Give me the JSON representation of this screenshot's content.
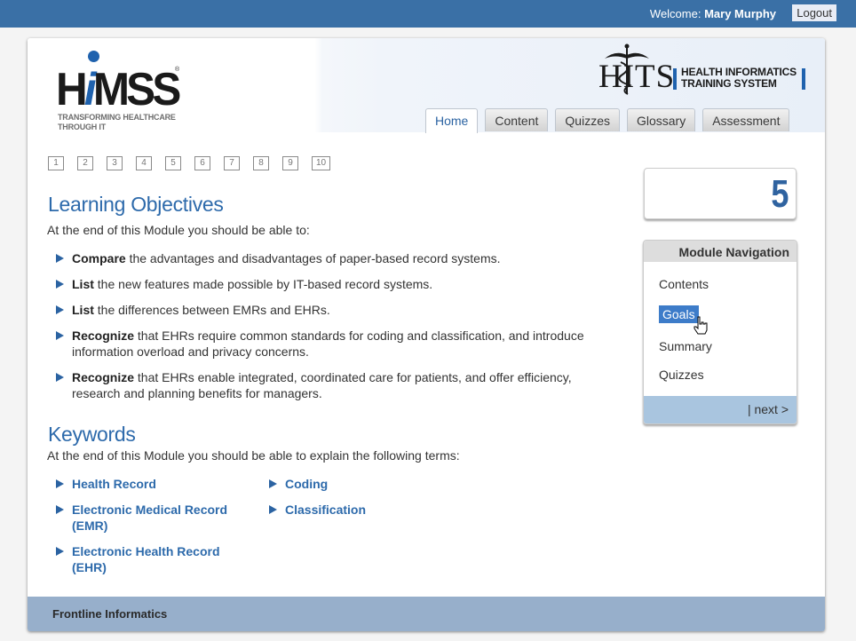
{
  "topbar": {
    "welcome_label": "Welcome:",
    "user_name": "Mary Murphy",
    "logout_label": "Logout"
  },
  "header": {
    "himss_logo": {
      "word_prefix": "H",
      "word_i": "i",
      "word_suffix": "MSS",
      "registered": "®",
      "tagline_line1": "TRANSFORMING HEALTHCARE",
      "tagline_line2": "THROUGH IT"
    },
    "hits_logo": {
      "letters": "HITS",
      "line1": "HEALTH INFORMATICS",
      "line2": "TRAINING SYSTEM"
    },
    "tabs": [
      {
        "label": "Home",
        "active": true
      },
      {
        "label": "Content",
        "active": false
      },
      {
        "label": "Quizzes",
        "active": false
      },
      {
        "label": "Glossary",
        "active": false
      },
      {
        "label": "Assessment",
        "active": false
      }
    ]
  },
  "pager": [
    "1",
    "2",
    "3",
    "4",
    "5",
    "6",
    "7",
    "8",
    "9",
    "10"
  ],
  "objectives": {
    "title": "Learning Objectives",
    "intro": "At the end of this Module you should be able to:",
    "items": [
      {
        "verb": "Compare",
        "text": " the advantages and disadvantages of paper-based record systems."
      },
      {
        "verb": "List",
        "text": " the new features made possible by IT-based record systems."
      },
      {
        "verb": "List",
        "text": " the differences between EMRs and EHRs."
      },
      {
        "verb": "Recognize",
        "text": " that EHRs require common standards for coding and classification, and introduce information overload and privacy concerns."
      },
      {
        "verb": "Recognize",
        "text": " that EHRs enable integrated, coordinated care for patients, and offer efficiency, research and planning benefits for managers."
      }
    ]
  },
  "keywords": {
    "title": "Keywords",
    "intro": "At the end of this Module you should be able to explain the following terms:",
    "col1": [
      "Health Record",
      "Electronic Medical Record (EMR)",
      "Electronic Health Record (EHR)"
    ],
    "col2": [
      "Coding",
      "Classification"
    ]
  },
  "module_number": "5",
  "module_nav": {
    "title": "Module Navigation",
    "items": [
      "Contents",
      "Goals",
      "Summary",
      "Quizzes"
    ],
    "selected": "Goals",
    "next_label": "| next >"
  },
  "footer": {
    "label": "Frontline Informatics"
  },
  "colors": {
    "topbar": "#3a70a6",
    "heading_blue": "#2d6aab",
    "selected_nav": "#3d7cc9",
    "nav_footer": "#a9c5df",
    "page_footer": "#97afcb"
  }
}
